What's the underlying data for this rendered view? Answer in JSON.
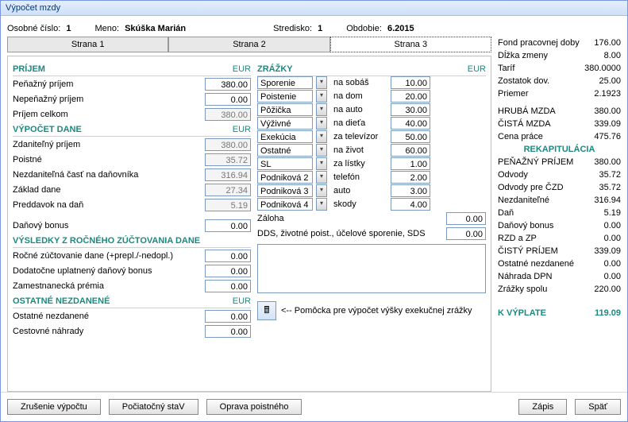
{
  "window": {
    "title": "Výpočet mzdy"
  },
  "header": {
    "osobne_cislo_label": "Osobné číslo:",
    "osobne_cislo": "1",
    "meno_label": "Meno:",
    "meno": "Skúška Marián",
    "stredisko_label": "Stredisko:",
    "stredisko": "1",
    "obdobie_label": "Obdobie:",
    "obdobie": "6.2015"
  },
  "info": {
    "fond_label": "Fond pracovnej doby",
    "fond": "176.00",
    "dlzka_label": "Dĺžka zmeny",
    "dlzka": "8.00",
    "tarif_label": "Taríf",
    "tarif": "380.0000",
    "zostatok_label": "Zostatok dov.",
    "zostatok": "25.00",
    "priemer_label": "Priemer",
    "priemer": "2.1923",
    "hruba_label": "HRUBÁ MZDA",
    "hruba": "380.00",
    "cista_label": "ČISTÁ MZDA",
    "cista": "339.09",
    "cena_label": "Cena práce",
    "cena": "475.76"
  },
  "tabs": {
    "t1": "Strana 1",
    "t2": "Strana 2",
    "t3": "Strana 3"
  },
  "prijem": {
    "title": "PRÍJEM",
    "eur": "EUR",
    "penazny_label": "Peňažný príjem",
    "penazny": "380.00",
    "nepenazny_label": "Nepeňažný príjem",
    "nepenazny": "0.00",
    "celkom_label": "Príjem celkom",
    "celkom": "380.00"
  },
  "dane": {
    "title": "VÝPOČET DANE",
    "eur": "EUR",
    "zdan_label": "Zdaniteľný príjem",
    "zdan": "380.00",
    "poistne_label": "Poistné",
    "poistne": "35.72",
    "nezdan_label": "Nezdaniteľná časť na daňovníka",
    "nezdan": "316.94",
    "zaklad_label": "Základ dane",
    "zaklad": "27.34",
    "preddavok_label": "Preddavok na daň",
    "preddavok": "5.19",
    "bonus_label": "Daňový bonus",
    "bonus": "0.00"
  },
  "rzd": {
    "title": "VÝSLEDKY Z ROČNÉHO ZÚČTOVANIA DANE",
    "rocne_label": "Ročné zúčtovanie dane (+prepl./-nedopl.)",
    "rocne": "0.00",
    "dodat_label": "Dodatočne uplatnený daňový bonus",
    "dodat": "0.00",
    "premia_label": "Zamestnanecká prémia",
    "premia": "0.00"
  },
  "ostatne": {
    "title": "OSTATNÉ NEZDANENÉ",
    "eur": "EUR",
    "ost_label": "Ostatné nezdanené",
    "ost": "0.00",
    "cest_label": "Cestovné náhrady",
    "cest": "0.00"
  },
  "zrazky": {
    "title": "ZRÁŽKY",
    "eur": "EUR",
    "items": [
      {
        "name": "Sporenie",
        "desc": "na sobáš",
        "val": "10.00"
      },
      {
        "name": "Poistenie",
        "desc": "na dom",
        "val": "20.00"
      },
      {
        "name": "Pôžička",
        "desc": "na auto",
        "val": "30.00"
      },
      {
        "name": "Výživné",
        "desc": "na dieťa",
        "val": "40.00"
      },
      {
        "name": "Exekúcia",
        "desc": "za televízor",
        "val": "50.00"
      },
      {
        "name": "Ostatné",
        "desc": "na život",
        "val": "60.00"
      },
      {
        "name": "SL",
        "desc": "za lístky",
        "val": "1.00"
      },
      {
        "name": "Podniková 2",
        "desc": "telefón",
        "val": "2.00"
      },
      {
        "name": "Podniková 3",
        "desc": "auto",
        "val": "3.00"
      },
      {
        "name": "Podniková 4",
        "desc": "skody",
        "val": "4.00"
      }
    ],
    "zaloha_label": "Záloha",
    "zaloha": "0.00",
    "dds_label": "DDS, životné poist., účelové sporenie, SDS",
    "dds": "0.00"
  },
  "calc_hint": "<--  Pomôcka pre výpočet výšky exekučnej zrážky",
  "rekap": {
    "title": "REKAPITULÁCIA",
    "rows": [
      {
        "label": "PEŇAŽNÝ PRÍJEM",
        "val": "380.00"
      },
      {
        "label": "Odvody",
        "val": "35.72"
      },
      {
        "label": "Odvody pre ČZD",
        "val": "35.72"
      },
      {
        "label": "Nezdaniteľné",
        "val": "316.94"
      },
      {
        "label": "Daň",
        "val": "5.19"
      },
      {
        "label": "Daňový bonus",
        "val": "0.00"
      },
      {
        "label": "RZD a ZP",
        "val": "0.00"
      },
      {
        "label": "ČISTÝ PRÍJEM",
        "val": "339.09"
      },
      {
        "label": "Ostatné nezdanené",
        "val": "0.00"
      },
      {
        "label": "Náhrada DPN",
        "val": "0.00"
      },
      {
        "label": "Zrážky spolu",
        "val": "220.00"
      }
    ],
    "final_label": "K VÝPLATE",
    "final_val": "119.09"
  },
  "buttons": {
    "zrusenie": "Zrušenie výpočtu",
    "pociatocny": "Počiatočný staV",
    "oprava": "Oprava poistného",
    "zapis": "Zápis",
    "spat": "Späť"
  }
}
